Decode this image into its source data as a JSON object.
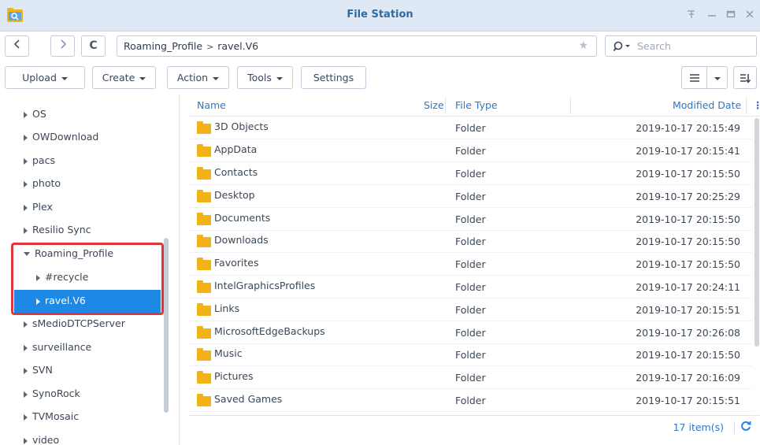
{
  "window": {
    "title": "File Station"
  },
  "nav": {
    "back": "<",
    "forward": ">",
    "refresh": "C"
  },
  "path": {
    "segments": [
      "Roaming_Profile",
      "ravel.V6"
    ],
    "separator": ">"
  },
  "search": {
    "placeholder": "Search"
  },
  "toolbar": {
    "upload": "Upload",
    "create": "Create",
    "action": "Action",
    "tools": "Tools",
    "settings": "Settings"
  },
  "sidebar": {
    "items": [
      {
        "label": "OS"
      },
      {
        "label": "OWDownload"
      },
      {
        "label": "pacs"
      },
      {
        "label": "photo"
      },
      {
        "label": "Plex"
      },
      {
        "label": "Resilio Sync"
      },
      {
        "label": "Roaming_Profile"
      },
      {
        "label": "#recycle"
      },
      {
        "label": "ravel.V6"
      },
      {
        "label": "sMedioDTCPServer"
      },
      {
        "label": "surveillance"
      },
      {
        "label": "SVN"
      },
      {
        "label": "SynoRock"
      },
      {
        "label": "TVMosaic"
      },
      {
        "label": "video"
      }
    ]
  },
  "list": {
    "columns": {
      "name": "Name",
      "size": "Size",
      "type": "File Type",
      "modified": "Modified Date"
    },
    "rows": [
      {
        "name": "3D Objects",
        "type": "Folder",
        "modified": "2019-10-17 20:15:49"
      },
      {
        "name": "AppData",
        "type": "Folder",
        "modified": "2019-10-17 20:15:41"
      },
      {
        "name": "Contacts",
        "type": "Folder",
        "modified": "2019-10-17 20:15:50"
      },
      {
        "name": "Desktop",
        "type": "Folder",
        "modified": "2019-10-17 20:25:29"
      },
      {
        "name": "Documents",
        "type": "Folder",
        "modified": "2019-10-17 20:15:50"
      },
      {
        "name": "Downloads",
        "type": "Folder",
        "modified": "2019-10-17 20:15:50"
      },
      {
        "name": "Favorites",
        "type": "Folder",
        "modified": "2019-10-17 20:15:50"
      },
      {
        "name": "IntelGraphicsProfiles",
        "type": "Folder",
        "modified": "2019-10-17 20:24:11"
      },
      {
        "name": "Links",
        "type": "Folder",
        "modified": "2019-10-17 20:15:51"
      },
      {
        "name": "MicrosoftEdgeBackups",
        "type": "Folder",
        "modified": "2019-10-17 20:26:08"
      },
      {
        "name": "Music",
        "type": "Folder",
        "modified": "2019-10-17 20:15:50"
      },
      {
        "name": "Pictures",
        "type": "Folder",
        "modified": "2019-10-17 20:16:09"
      },
      {
        "name": "Saved Games",
        "type": "Folder",
        "modified": "2019-10-17 20:15:51"
      }
    ]
  },
  "footer": {
    "count": "17 item(s)"
  },
  "colors": {
    "accent": "#1e88e5",
    "header_text": "#2f77c4",
    "highlight": "#e0353d",
    "folder": "#f2b318"
  }
}
